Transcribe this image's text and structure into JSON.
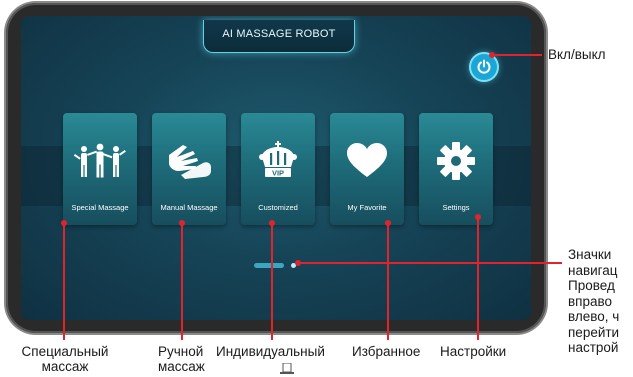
{
  "header": {
    "title": "AI MASSAGE ROBOT"
  },
  "tiles": [
    {
      "label": "Special Massage",
      "icon": "people-icon"
    },
    {
      "label": "Manual Massage",
      "icon": "hands-icon"
    },
    {
      "label": "Customized",
      "icon": "crown-vip-icon",
      "badge": "VIP"
    },
    {
      "label": "My Favorite",
      "icon": "heart-icon"
    },
    {
      "label": "Settings",
      "icon": "gear-icon"
    }
  ],
  "annotations": {
    "power": "Вкл/выкл",
    "nav_lines": [
      "Значки",
      "навигац",
      "Провед",
      "вправо",
      "влево, ч",
      "перейти",
      "настрой"
    ],
    "special": [
      "Специальный",
      "массаж"
    ],
    "manual": [
      "Ручной",
      "массаж"
    ],
    "custom": "Индивидуальный",
    "favorite": "Избранное",
    "settings": "Настройки"
  },
  "colors": {
    "accent": "#5fd2e6",
    "callout": "#e1242c",
    "tile": "#1e6c7a",
    "screen": "#164457"
  }
}
